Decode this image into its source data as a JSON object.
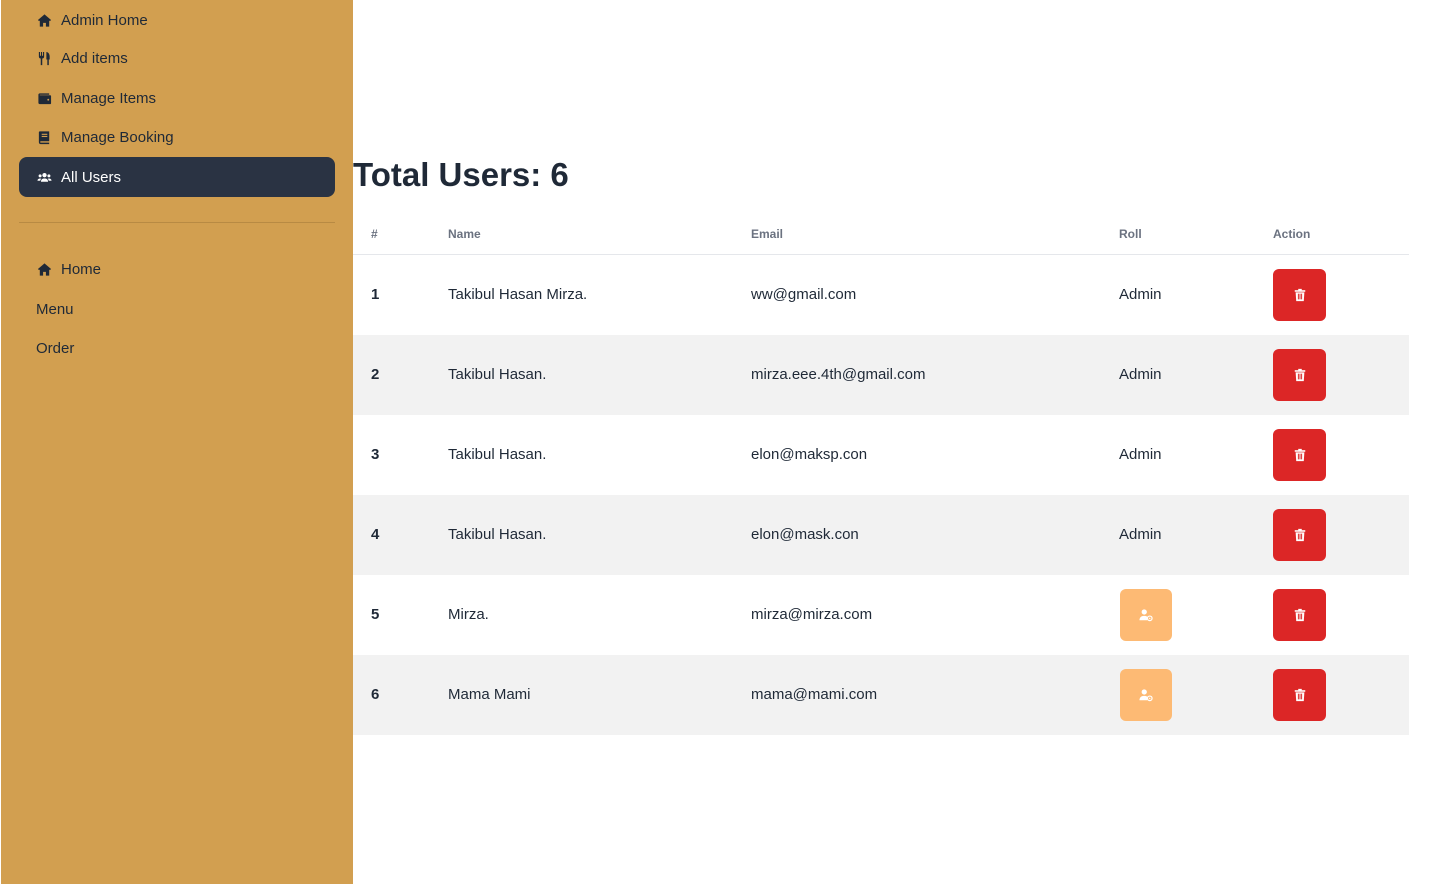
{
  "sidebar": {
    "admin_items": [
      {
        "label": "Admin Home",
        "icon": "home-icon"
      },
      {
        "label": "Add items",
        "icon": "utensils-icon"
      },
      {
        "label": "Manage Items",
        "icon": "wallet-icon"
      },
      {
        "label": "Manage Booking",
        "icon": "book-icon"
      },
      {
        "label": "All Users",
        "icon": "users-icon",
        "active": true
      }
    ],
    "main_items": [
      {
        "label": "Home",
        "icon": "home-icon"
      },
      {
        "label": "Menu"
      },
      {
        "label": "Order"
      }
    ]
  },
  "main": {
    "title": "Total Users: 6"
  },
  "table": {
    "headers": [
      "#",
      "Name",
      "Email",
      "Roll",
      "Action"
    ],
    "rows": [
      {
        "index": "1",
        "name": "Takibul Hasan Mirza.",
        "email": "ww@gmail.com",
        "role": "Admin"
      },
      {
        "index": "2",
        "name": "Takibul Hasan.",
        "email": "mirza.eee.4th@gmail.com",
        "role": "Admin"
      },
      {
        "index": "3",
        "name": "Takibul Hasan.",
        "email": "elon@maksp.con",
        "role": "Admin"
      },
      {
        "index": "4",
        "name": "Takibul Hasan.",
        "email": "elon@mask.con",
        "role": "Admin"
      },
      {
        "index": "5",
        "name": "Mirza.",
        "email": "mirza@mirza.com",
        "role_button_icon": "user-gear-icon"
      },
      {
        "index": "6",
        "name": "Mama Mami",
        "email": "mama@mami.com",
        "role_button_icon": "user-gear-icon"
      }
    ],
    "delete_icon": "trash-icon"
  },
  "colors": {
    "sidebar_bg": "#d29f50",
    "active_item_bg": "#2a3343",
    "delete_button": "#dc2626",
    "role_button": "#fdba74",
    "striped_row": "#f2f2f2"
  }
}
